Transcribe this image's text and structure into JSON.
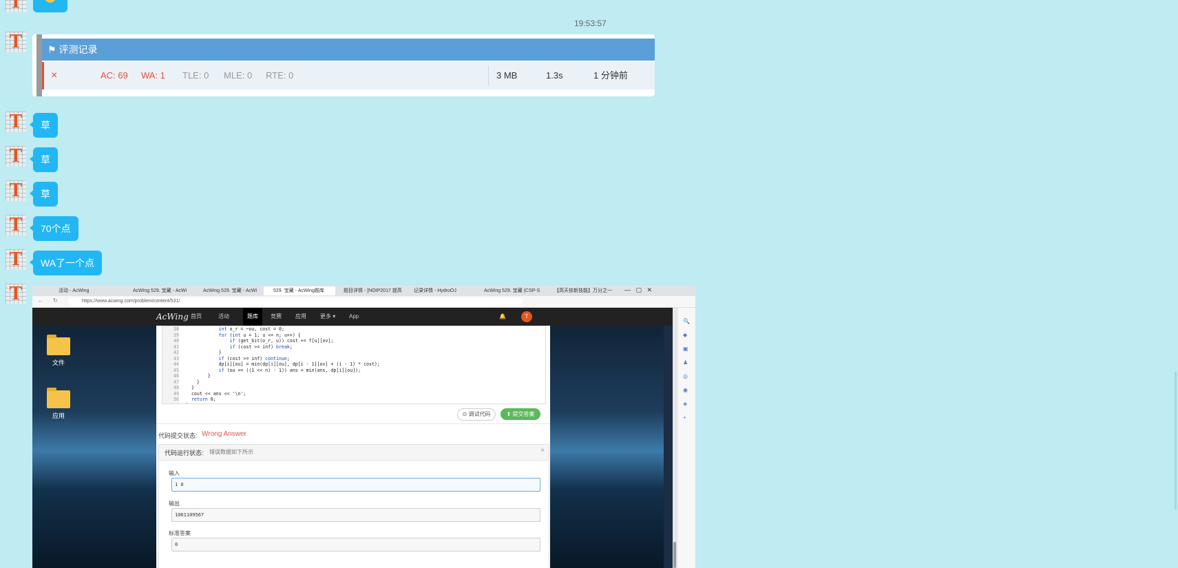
{
  "chat": {
    "timestamp": "19:53:57",
    "messages": [
      {
        "text": "草"
      },
      {
        "text": "草"
      },
      {
        "text": "草"
      },
      {
        "text": "70个点"
      },
      {
        "text": "WA了一个点"
      }
    ]
  },
  "judge": {
    "title": "评测记录",
    "status_icon": "×",
    "ac": "AC: 69",
    "wa": "WA: 1",
    "tle": "TLE: 0",
    "mle": "MLE: 0",
    "rte": "RTE: 0",
    "memory": "3 MB",
    "time": "1.3s",
    "ago": "1 分钟前",
    "colors": {
      "header": "#5b9fd8",
      "error": "#e74c3c"
    }
  },
  "browser": {
    "tabs": [
      {
        "label": "活动 - AcWing"
      },
      {
        "label": "AcWing 529. 宝藏 - AcWi"
      },
      {
        "label": "AcWing 529. 宝藏 - AcWi"
      },
      {
        "label": "529. 宝藏 - AcWing题库"
      },
      {
        "label": "题目详情 - [NOIP2017 提高"
      },
      {
        "label": "记录详情 - HydroOJ"
      },
      {
        "label": "AcWing 529. 宝藏 (CSP-S"
      },
      {
        "label": "【高天依新技能】万分之一"
      }
    ],
    "url": "https://www.acwing.com/problem/content/531/",
    "nav": {
      "logo": "AcWing",
      "items": [
        "首页",
        "活动",
        "题库",
        "竞赛",
        "应用",
        "更多 ▾",
        "App"
      ]
    },
    "desktop": [
      {
        "label": "文件"
      },
      {
        "label": "应用"
      }
    ],
    "code_lines": [
      {
        "n": "38",
        "t": "            int o_r = ~ou, cost = 0;"
      },
      {
        "n": "39",
        "t": "            for (int u = 1; u <= n; u++) {"
      },
      {
        "n": "40",
        "t": "                if (get_bit(o_r, u)) cost += f[u][ov];"
      },
      {
        "n": "41",
        "t": "                if (cost >= inf) break;"
      },
      {
        "n": "42",
        "t": "            }"
      },
      {
        "n": "43",
        "t": "            if (cost >= inf) continue;"
      },
      {
        "n": "44",
        "t": "            dp[i][ou] = min(dp[i][ou], dp[i - 1][ov] + (i - 1) * cost);"
      },
      {
        "n": "45",
        "t": "            if (ou == ((1 << n) - 1)) ans = min(ans, dp[i][ou]);"
      },
      {
        "n": "46",
        "t": "        }"
      },
      {
        "n": "47",
        "t": "    }"
      },
      {
        "n": "48",
        "t": "  }"
      },
      {
        "n": "49",
        "t": "  cout << ans << '\\n';"
      },
      {
        "n": "50",
        "t": "  return 0;"
      },
      {
        "n": "51",
        "t": "}"
      }
    ],
    "debug_button": "调试代码",
    "submit_button": "提交答案",
    "submit_status_label": "代码提交状态:",
    "submit_status_value": "Wrong Answer",
    "run_status_label": "代码运行状态:",
    "run_status_value": "错误数据如下所示",
    "input_label": "输入",
    "input_value": "1 0",
    "output_label": "输出",
    "output_value": "1061109567",
    "expected_label": "标准答案",
    "expected_value": "0"
  }
}
